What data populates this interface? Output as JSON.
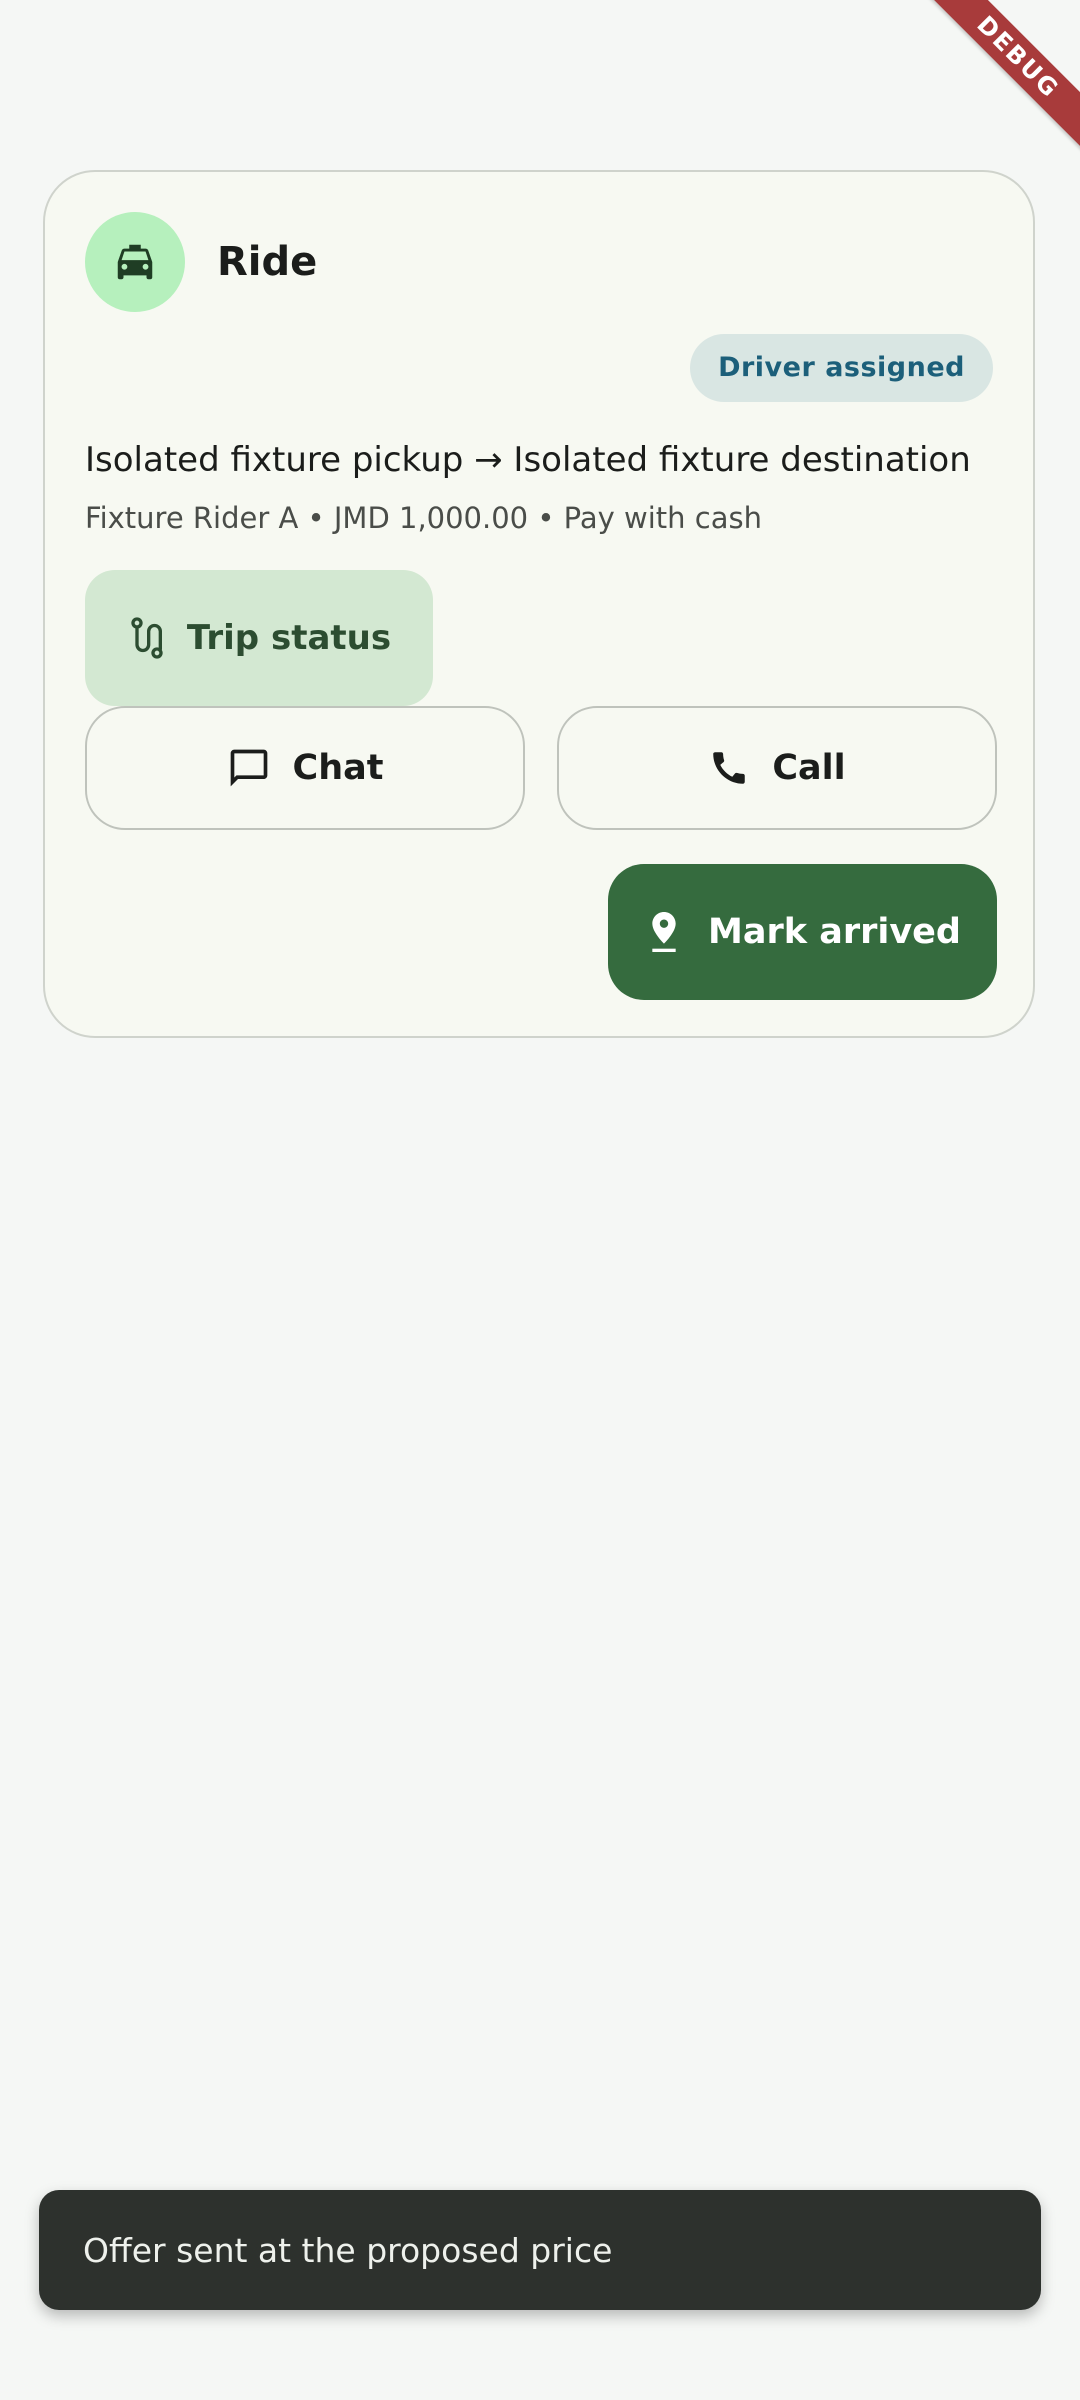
{
  "debug_banner": {
    "label": "DEBUG"
  },
  "card": {
    "icon": "taxi-icon",
    "title": "Ride",
    "status": "Driver assigned",
    "route": "Isolated fixture pickup → Isolated fixture destination",
    "meta": "Fixture Rider A • JMD 1,000.00 • Pay with cash",
    "trip_status_button": {
      "label": "Trip status",
      "icon": "route-icon"
    },
    "chat_button": {
      "label": "Chat",
      "icon": "chat-bubble-icon"
    },
    "call_button": {
      "label": "Call",
      "icon": "phone-icon"
    },
    "mark_arrived_button": {
      "label": "Mark arrived",
      "icon": "location-pin-icon"
    }
  },
  "snackbar": {
    "message": "Offer sent at the proposed price"
  },
  "colors": {
    "background": "#f5f7f5",
    "card_background": "#f7f9f2",
    "avatar": "#b6f0bd",
    "status_badge_bg": "#d9e6e3",
    "status_badge_text": "#1c5f7a",
    "tonal_button": "#d3e8d2",
    "primary_button": "#356b3e",
    "snackbar": "#2d312d"
  }
}
